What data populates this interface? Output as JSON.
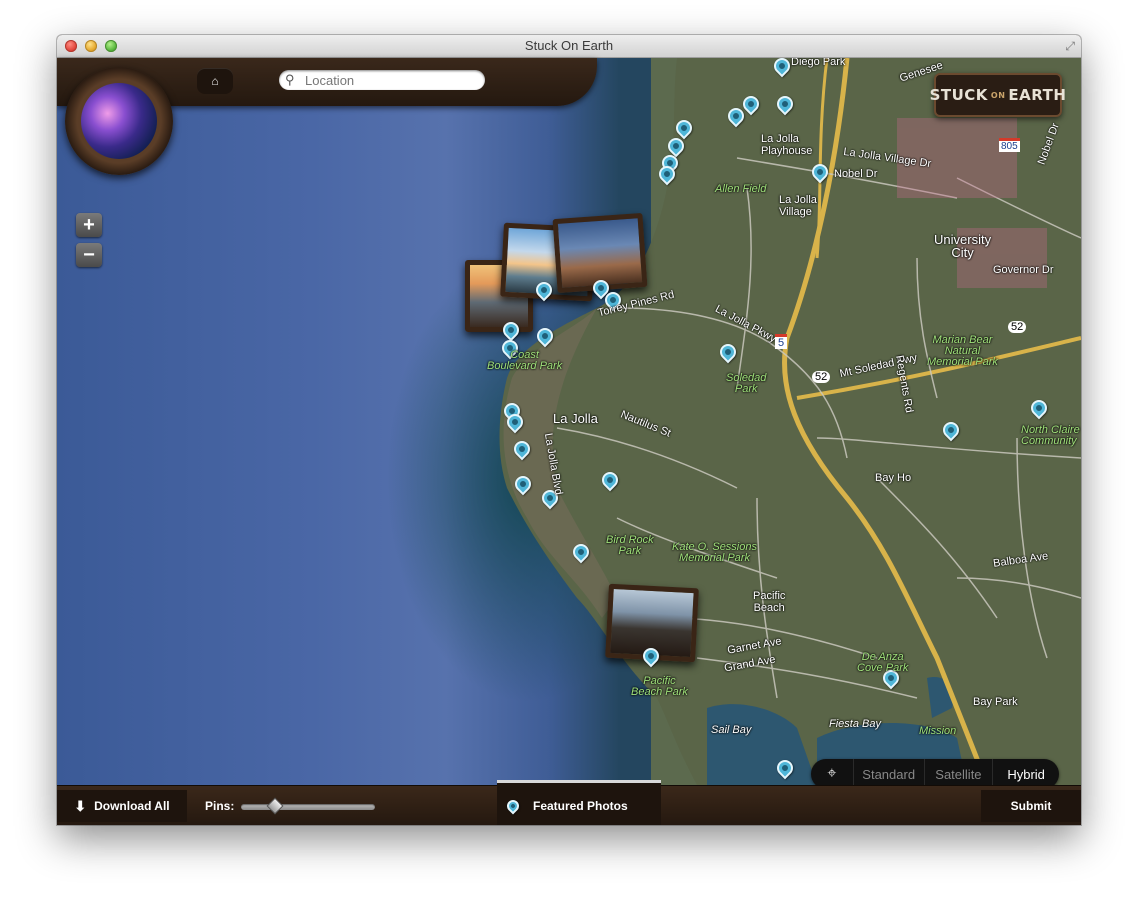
{
  "window": {
    "title": "Stuck On Earth"
  },
  "search": {
    "placeholder": "Location",
    "value": ""
  },
  "zoom": {
    "in_label": "+",
    "out_label": "−"
  },
  "logo": {
    "left": "STUCK",
    "mid": "ON",
    "right": "EARTH"
  },
  "map_labels": {
    "diego_park": "Diego Park",
    "genesee": "Genesee",
    "la_jolla_playhouse": "La Jolla\nPlayhouse",
    "la_jolla_village_dr": "La Jolla Village Dr",
    "nobel_dr": "Nobel Dr",
    "nobel_dr2": "Nobel Dr",
    "allen_field": "Allen Field",
    "la_jolla_village": "La Jolla\nVillage",
    "university_city": "University\nCity",
    "governor_dr": "Governor Dr",
    "torrey_pines_rd": "Torrey Pines Rd",
    "la_jolla_pkwy": "La Jolla Pkwy",
    "coast_blvd_park": "Coast\nBoulevard Park",
    "soledad_park": "Soledad\nPark",
    "mt_soledad_fwy": "Mt Soledad Fwy",
    "marian_bear": "Marian Bear\nNatural\nMemorial Park",
    "regents_rd": "Regents Rd",
    "la_jolla": "La Jolla",
    "nautilus_st": "Nautilus St",
    "la_jolla_blvd": "La Jolla Blvd",
    "north_clairemont": "North Claire\nCommunity",
    "bay_ho": "Bay Ho",
    "bird_rock_park": "Bird Rock\nPark",
    "kate_sessions": "Kate O. Sessions\nMemorial Park",
    "pacific_beach": "Pacific\nBeach",
    "garnet_ave": "Garnet Ave",
    "grand_ave": "Grand Ave",
    "balboa_ave": "Balboa Ave",
    "pacific_beach_park": "Pacific\nBeach Park",
    "de_anza_cove": "De Anza\nCove Park",
    "sail_bay": "Sail Bay",
    "fiesta_bay": "Fiesta Bay",
    "mission": "Mission",
    "bay_park": "Bay Park",
    "highway_5": "5",
    "highway_52": "52",
    "highway_805": "805"
  },
  "map_modes": {
    "standard": "Standard",
    "satellite": "Satellite",
    "hybrid": "Hybrid",
    "active": "Hybrid"
  },
  "bottom_bar": {
    "download_all": "Download All",
    "pins_label": "Pins:",
    "pins_slider_value": 0.25,
    "featured_photos": "Featured Photos",
    "submit": "Submit"
  },
  "colors": {
    "pin": "#4fb6d8",
    "frame": "#3a2516",
    "park_label": "#9fe07a"
  }
}
